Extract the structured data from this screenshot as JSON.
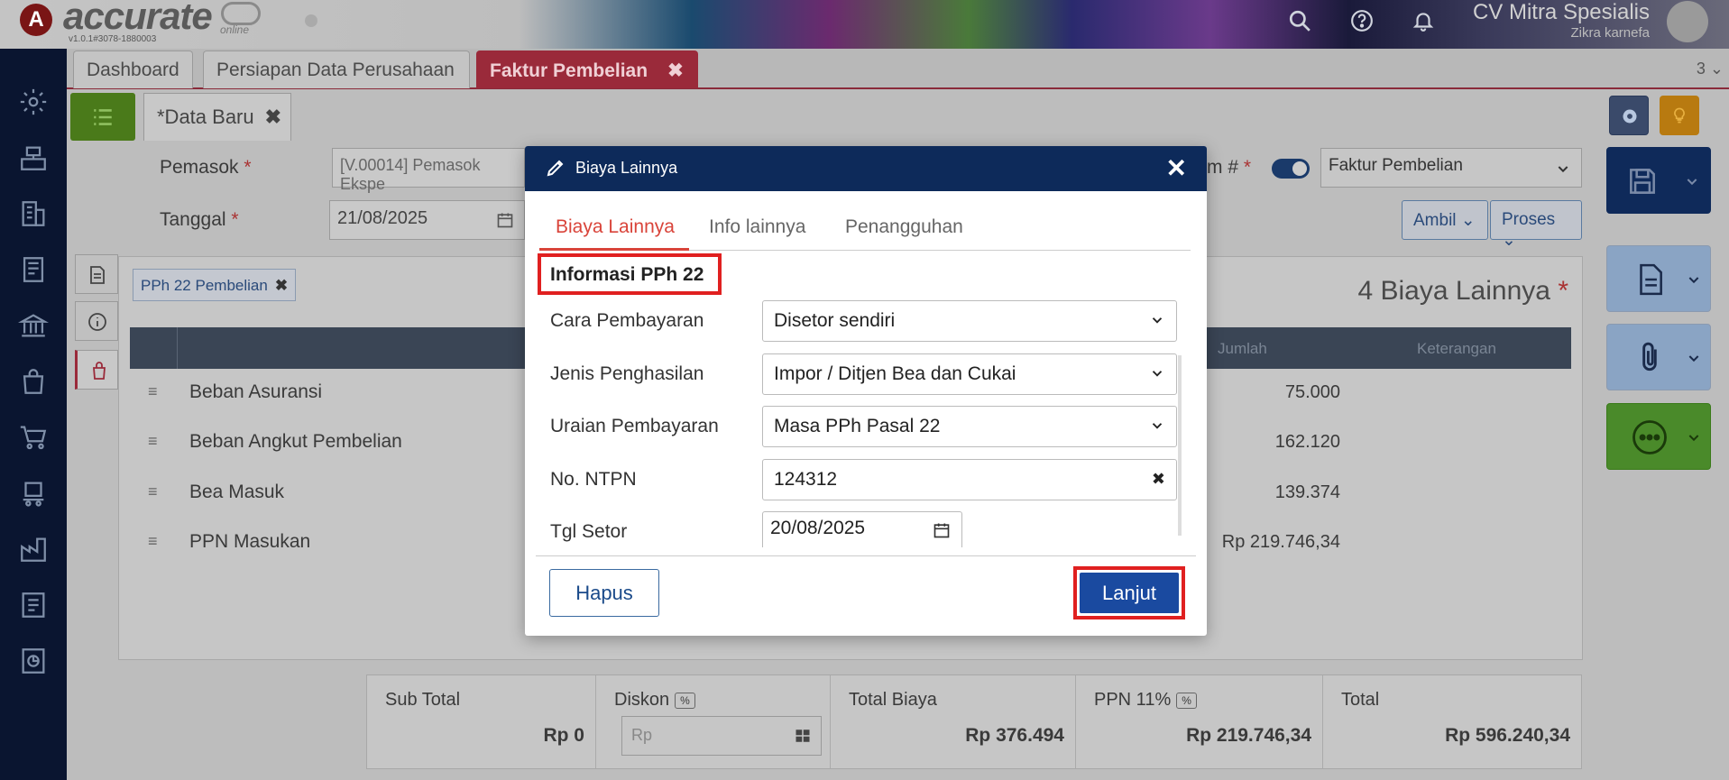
{
  "app": {
    "logo_letter": "A",
    "logo_text": "accurate",
    "logo_online": "online",
    "version": "v1.0.1#3078-1880003",
    "company": "CV Mitra Spesialis",
    "user": "Zikra karnefa"
  },
  "tabs": [
    {
      "label": "Dashboard"
    },
    {
      "label": "Persiapan Data Perusahaan"
    },
    {
      "label": "Faktur Pembelian",
      "close": "✖"
    }
  ],
  "tab_count": "3",
  "subtab": {
    "label": "*Data Baru",
    "close": "✖"
  },
  "form": {
    "pemasok_label": "Pemasok",
    "pemasok_value": "[V.00014] Pemasok Ekspe",
    "tanggal_label": "Tanggal",
    "tanggal_value": "21/08/2025",
    "form_label": "m #",
    "form_type": "Faktur Pembelian",
    "ambil": "Ambil",
    "proses": "Proses",
    "required_mark": "*"
  },
  "panel": {
    "chip": "PPh 22 Pembelian",
    "chip_close": "✖",
    "title": "4 Biaya Lainnya",
    "title_mark": "*",
    "columns": {
      "jumlah": "Jumlah",
      "keterangan": "Keterangan"
    },
    "rows": [
      {
        "label": "Beban Asuransi",
        "value": "75.000"
      },
      {
        "label": "Beban Angkut Pembelian",
        "value": "162.120"
      },
      {
        "label": "Bea Masuk",
        "value": "139.374"
      },
      {
        "label": "PPN Masukan",
        "value": "Rp 219.746,34"
      }
    ]
  },
  "summary": {
    "sub_total_label": "Sub Total",
    "sub_total": "Rp 0",
    "diskon_label": "Diskon",
    "diskon_pct": "%",
    "diskon_placeholder": "Rp",
    "total_biaya_label": "Total Biaya",
    "total_biaya": "Rp 376.494",
    "ppn_label": "PPN 11%",
    "ppn_pct": "%",
    "ppn": "Rp 219.746,34",
    "total_label": "Total",
    "total": "Rp 596.240,34"
  },
  "modal": {
    "title": "Biaya Lainnya",
    "close": "✕",
    "tabs": [
      "Biaya Lainnya",
      "Info lainnya",
      "Penangguhan"
    ],
    "section": "Informasi PPh 22",
    "fields": {
      "cara_label": "Cara Pembayaran",
      "cara_value": "Disetor sendiri",
      "jenis_label": "Jenis Penghasilan",
      "jenis_value": "Impor / Ditjen Bea dan Cukai",
      "uraian_label": "Uraian Pembayaran",
      "uraian_value": "Masa PPh Pasal 22",
      "ntpn_label": "No. NTPN",
      "ntpn_value": "124312",
      "ntpn_clear": "✖",
      "tgl_label": "Tgl Setor",
      "tgl_value": "20/08/2025"
    },
    "hapus": "Hapus",
    "lanjut": "Lanjut"
  },
  "colors": {
    "sidebar": "#0a1530",
    "modal_header": "#0d2a5a",
    "accent_red": "#d9443a",
    "highlight": "#e02020",
    "primary_button": "#1a4aa0"
  }
}
